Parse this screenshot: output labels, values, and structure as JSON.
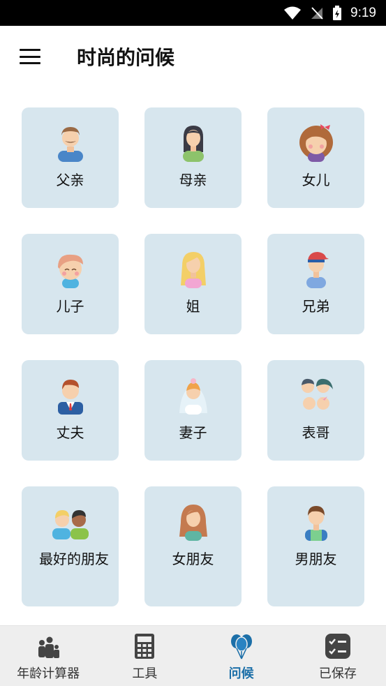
{
  "status": {
    "time": "9:19"
  },
  "header": {
    "title": "时尚的问候"
  },
  "cards": [
    {
      "label": "父亲"
    },
    {
      "label": "母亲"
    },
    {
      "label": "女儿"
    },
    {
      "label": "儿子"
    },
    {
      "label": "姐"
    },
    {
      "label": "兄弟"
    },
    {
      "label": "丈夫"
    },
    {
      "label": "妻子"
    },
    {
      "label": "表哥"
    },
    {
      "label": "最好的朋友"
    },
    {
      "label": "女朋友"
    },
    {
      "label": "男朋友"
    }
  ],
  "nav": [
    {
      "label": "年龄计算器",
      "icon": "family-icon"
    },
    {
      "label": "工具",
      "icon": "calculator-icon"
    },
    {
      "label": "问候",
      "icon": "balloons-icon",
      "active": true
    },
    {
      "label": "已保存",
      "icon": "checklist-icon"
    }
  ],
  "colors": {
    "accent": "#1c6fa8",
    "card_bg": "#d7e6ee",
    "nav_bg": "#eeeeee"
  }
}
